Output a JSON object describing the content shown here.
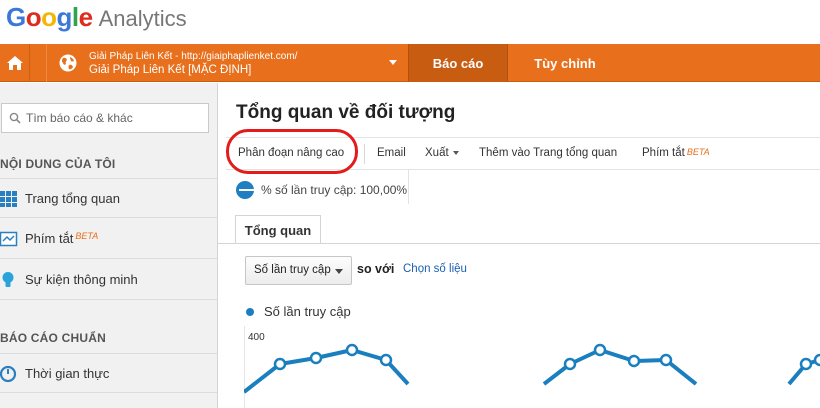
{
  "logo": {
    "google": [
      "G",
      "o",
      "o",
      "g",
      "l",
      "e"
    ],
    "google_colors": [
      "#3c78d8",
      "#dd2c1d",
      "#f2b705",
      "#3c78d8",
      "#2ea54b",
      "#dd2c1d"
    ],
    "analytics": "Analytics"
  },
  "account": {
    "line1": "Giải Pháp Liên Kết - http://giaiphaplienket.com/",
    "line2": "Giải Pháp Liên Kết [MẶC ĐỊNH]"
  },
  "topnav": {
    "reports": "Báo cáo",
    "customize": "Tùy chỉnh"
  },
  "colors": {
    "orange": "#e8701d",
    "orange_dark": "#c85d12",
    "line": "#1a7fbf",
    "annotation": "#e21b1b"
  },
  "sidebar": {
    "search_placeholder": "Tìm báo cáo & khác",
    "section_mine": "NỘI DUNG CỦA TÔI",
    "items_mine": [
      {
        "label": "Trang tổng quan",
        "icon": "dashboard-icon"
      },
      {
        "label": "Phím tắt",
        "beta": "BETA",
        "icon": "shortcut-icon"
      },
      {
        "label": "Sự kiện thông minh",
        "icon": "lightbulb-icon"
      }
    ],
    "section_standard": "BÁO CÁO CHUẨN",
    "items_standard": [
      {
        "label": "Thời gian thực",
        "icon": "realtime-icon"
      }
    ]
  },
  "page": {
    "title": "Tổng quan về đối tượng",
    "toolbar": {
      "advanced_segments": "Phân đoạn nâng cao",
      "email": "Email",
      "export": "Xuất",
      "add_to_dashboard": "Thêm vào Trang tổng quan",
      "shortcut": "Phím tắt",
      "beta": "BETA"
    },
    "segment_label": "% số lần truy cập: 100,00%",
    "tab_overview": "Tổng quan",
    "metric_select": "Số lần truy cập",
    "compare_text": "so với",
    "choose_metric_link": "Chọn số liệu",
    "legend": "Số lần truy cập"
  },
  "chart_data": {
    "type": "line",
    "series": [
      {
        "name": "Số lần truy cập"
      }
    ],
    "y_tick": "400"
  }
}
